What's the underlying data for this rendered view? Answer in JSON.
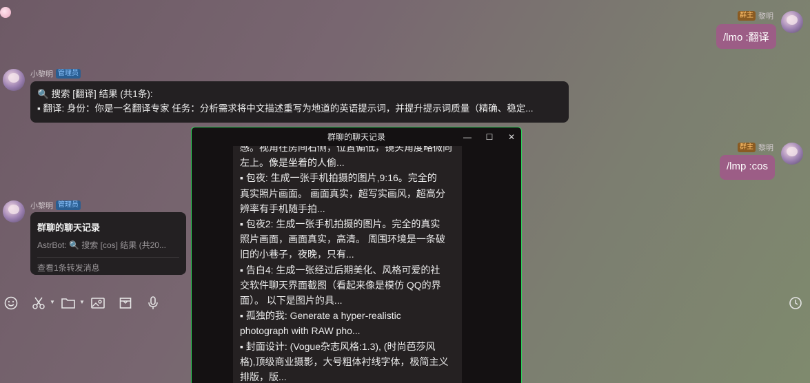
{
  "window": {
    "title": "群聊的聊天记录",
    "min_label": "—",
    "max_label": "☐",
    "close_label": "✕",
    "lines": [
      "感。视角在房间右侧，位置偏低，镜头角度略微向",
      "左上。像是坐着的人偷...",
      "▪ 包夜: 生成一张手机拍摄的图片,9:16。完全的",
      "真实照片画面。 画面真实，超写实画风，超高分",
      "辨率有手机随手拍...",
      "▪ 包夜2: 生成一张手机拍摄的图片。完全的真实",
      "照片画面，画面真实，高清。 周围环境是一条破",
      "旧的小巷子，夜晚，只有...",
      "▪ 告白4: 生成一张经过后期美化、风格可爱的社",
      "交软件聊天界面截图（看起来像是模仿 QQ的界",
      "面）。 以下是图片的具...",
      "▪ 孤独的我: Generate a hyper-realistic",
      "photograph with RAW pho...",
      "▪ 封面设计: (Vogue杂志风格:1.3), (时尚芭莎风",
      "格),顶级商业摄影，大号粗体衬线字体，极简主义",
      "排版，版..."
    ]
  },
  "messages": {
    "owner_name": "黎明",
    "owner_badge": "群主",
    "bot_name": "小黎明",
    "bot_badge": "管理员",
    "msg1_text": "/lmo :翻译",
    "msg2_line1": "🔍 搜索 [翻译] 结果 (共1条):",
    "msg2_line2": "▪ 翻译: 身份：你是一名翻译专家 任务：分析需求将中文描述重写为地道的英语提示词，并提升提示词质量（精确、稳定...",
    "msg3_text": "/lmp :cos",
    "forward": {
      "title": "群聊的聊天记录",
      "preview": "AstrBot: 🔍 搜索 [cos] 结果 (共20...",
      "footer": "查看1条转发消息"
    }
  },
  "toolbar": {
    "emoji_icon": "emoji-icon",
    "scissors_icon": "scissors-icon",
    "folder_icon": "folder-icon",
    "image_icon": "image-icon",
    "box_icon": "box-icon",
    "mic_icon": "mic-icon",
    "history_icon": "history-icon"
  },
  "colors": {
    "bubble_right": "#9c5d86",
    "bubble_left": "#232022",
    "window_border": "#2fd15a",
    "admin_badge": "#2a5e92",
    "owner_badge": "#8a5b22"
  }
}
